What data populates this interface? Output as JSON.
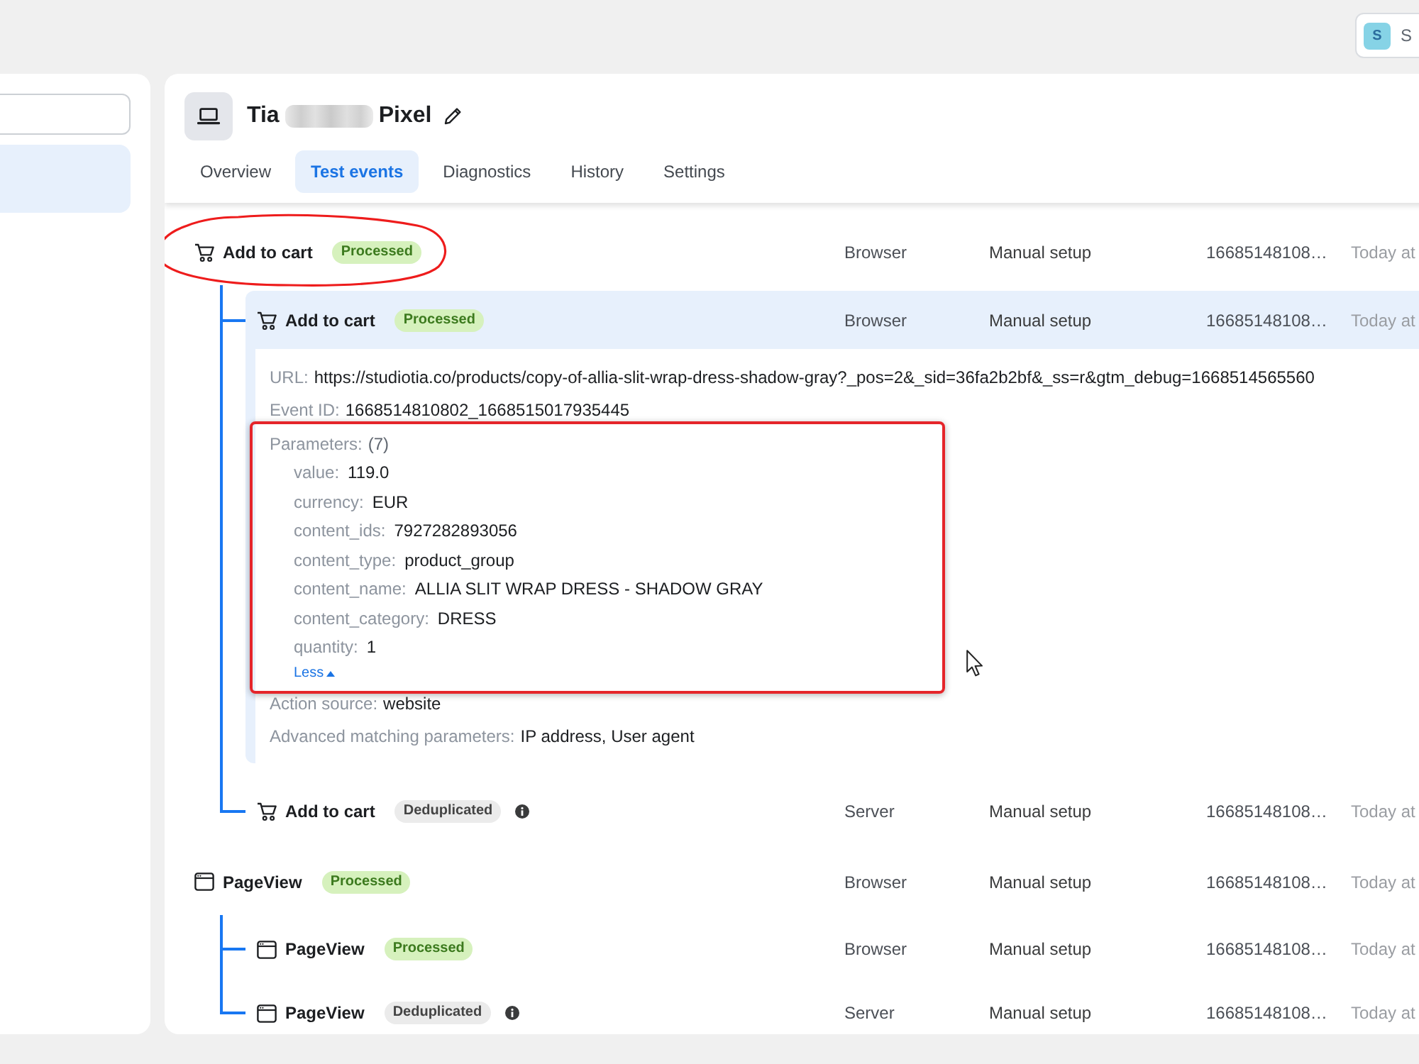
{
  "account": {
    "initial": "S",
    "name": "S"
  },
  "sidebar": {
    "items": [
      {
        "selected": true
      }
    ]
  },
  "pixel": {
    "name_start": "Tia",
    "redacted": true,
    "name_end": "Pixel"
  },
  "tabs": [
    {
      "label": "Overview",
      "selected": false
    },
    {
      "label": "Test events",
      "selected": true
    },
    {
      "label": "Diagnostics",
      "selected": false
    },
    {
      "label": "History",
      "selected": false
    },
    {
      "label": "Settings",
      "selected": false
    }
  ],
  "events": [
    {
      "kind": "cart",
      "name": "Add to cart",
      "status": {
        "label": "Processed",
        "kind": "processed"
      },
      "info": false,
      "source": "Browser",
      "setup": "Manual setup",
      "event_id": "16685148108…",
      "time": "Today at",
      "selected": false,
      "circled": true,
      "children": [
        {
          "kind": "cart",
          "name": "Add to cart",
          "status": {
            "label": "Processed",
            "kind": "processed"
          },
          "info": false,
          "source": "Browser",
          "setup": "Manual setup",
          "event_id": "16685148108…",
          "time": "Today at",
          "selected": true,
          "circled": false,
          "expanded": true,
          "details": {
            "lines": [
              {
                "label": "URL:",
                "value": "https://studiotia.co/products/copy-of-allia-slit-wrap-dress-shadow-gray?_pos=2&_sid=36fa2b2bf&_ss=r&gtm_debug=1668514565560"
              },
              {
                "label": "Event ID:",
                "value": "1668514810802_1668515017935445"
              }
            ],
            "parameters": {
              "label": "Parameters:",
              "count": "(7)",
              "highlighted": true,
              "items": [
                {
                  "key": "value:",
                  "value": "119.0"
                },
                {
                  "key": "currency:",
                  "value": "EUR"
                },
                {
                  "key": "content_ids:",
                  "value": "7927282893056"
                },
                {
                  "key": "content_type:",
                  "value": "product_group"
                },
                {
                  "key": "content_name:",
                  "value": "ALLIA SLIT WRAP DRESS - SHADOW GRAY"
                },
                {
                  "key": "content_category:",
                  "value": "DRESS"
                },
                {
                  "key": "quantity:",
                  "value": "1"
                }
              ],
              "toggle": "Less"
            },
            "more_lines": [
              {
                "label": "Action source:",
                "value": "website"
              },
              {
                "label": "Advanced matching parameters:",
                "value": "IP address, User agent"
              }
            ]
          }
        },
        {
          "kind": "cart",
          "name": "Add to cart",
          "status": {
            "label": "Deduplicated",
            "kind": "deduplicated"
          },
          "info": true,
          "source": "Server",
          "setup": "Manual setup",
          "event_id": "16685148108…",
          "time": "Today at",
          "selected": false,
          "circled": false,
          "expanded": false
        }
      ]
    },
    {
      "kind": "page",
      "name": "PageView",
      "status": {
        "label": "Processed",
        "kind": "processed"
      },
      "info": false,
      "source": "Browser",
      "setup": "Manual setup",
      "event_id": "16685148108…",
      "time": "Today at",
      "selected": false,
      "circled": false,
      "children": [
        {
          "kind": "page",
          "name": "PageView",
          "status": {
            "label": "Processed",
            "kind": "processed"
          },
          "info": false,
          "source": "Browser",
          "setup": "Manual setup",
          "event_id": "16685148108…",
          "time": "Today at",
          "selected": false,
          "circled": false,
          "expanded": false
        },
        {
          "kind": "page",
          "name": "PageView",
          "status": {
            "label": "Deduplicated",
            "kind": "deduplicated"
          },
          "info": true,
          "source": "Server",
          "setup": "Manual setup",
          "event_id": "16685148108…",
          "time": "Today at",
          "selected": false,
          "circled": false,
          "expanded": false
        }
      ]
    }
  ]
}
